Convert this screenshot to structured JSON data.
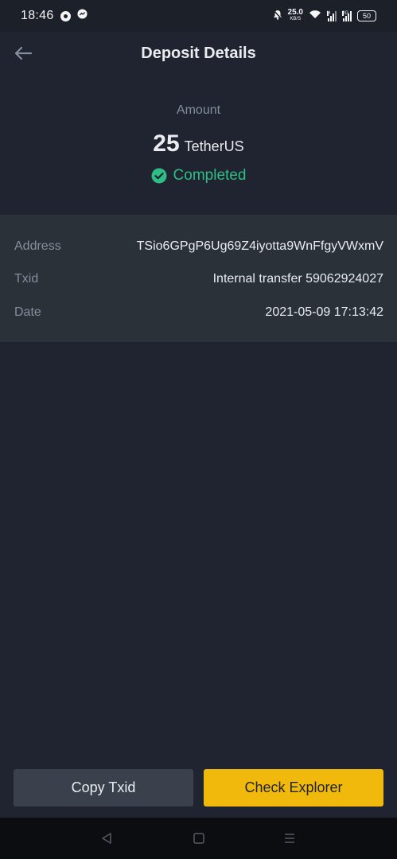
{
  "status_bar": {
    "time": "18:46",
    "speed_value": "25.0",
    "speed_unit": "KB/S",
    "network_tag_1": "H",
    "network_tag_2": "2G",
    "battery": "50"
  },
  "header": {
    "title": "Deposit Details"
  },
  "summary": {
    "amount_label": "Amount",
    "amount_value": "25",
    "amount_unit": "TetherUS",
    "status": "Completed",
    "status_color": "#2ebd85"
  },
  "details": [
    {
      "label": "Address",
      "value": "TSio6GPgP6Ug69Z4iyotta9WnFfgyVWxmV"
    },
    {
      "label": "Txid",
      "value": "Internal transfer 59062924027"
    },
    {
      "label": "Date",
      "value": "2021-05-09 17:13:42"
    }
  ],
  "buttons": {
    "copy_txid": "Copy Txid",
    "check_explorer": "Check Explorer"
  },
  "colors": {
    "background": "#1f2430",
    "card": "#2b3139",
    "accent": "#f0b90b",
    "success": "#2ebd85"
  }
}
